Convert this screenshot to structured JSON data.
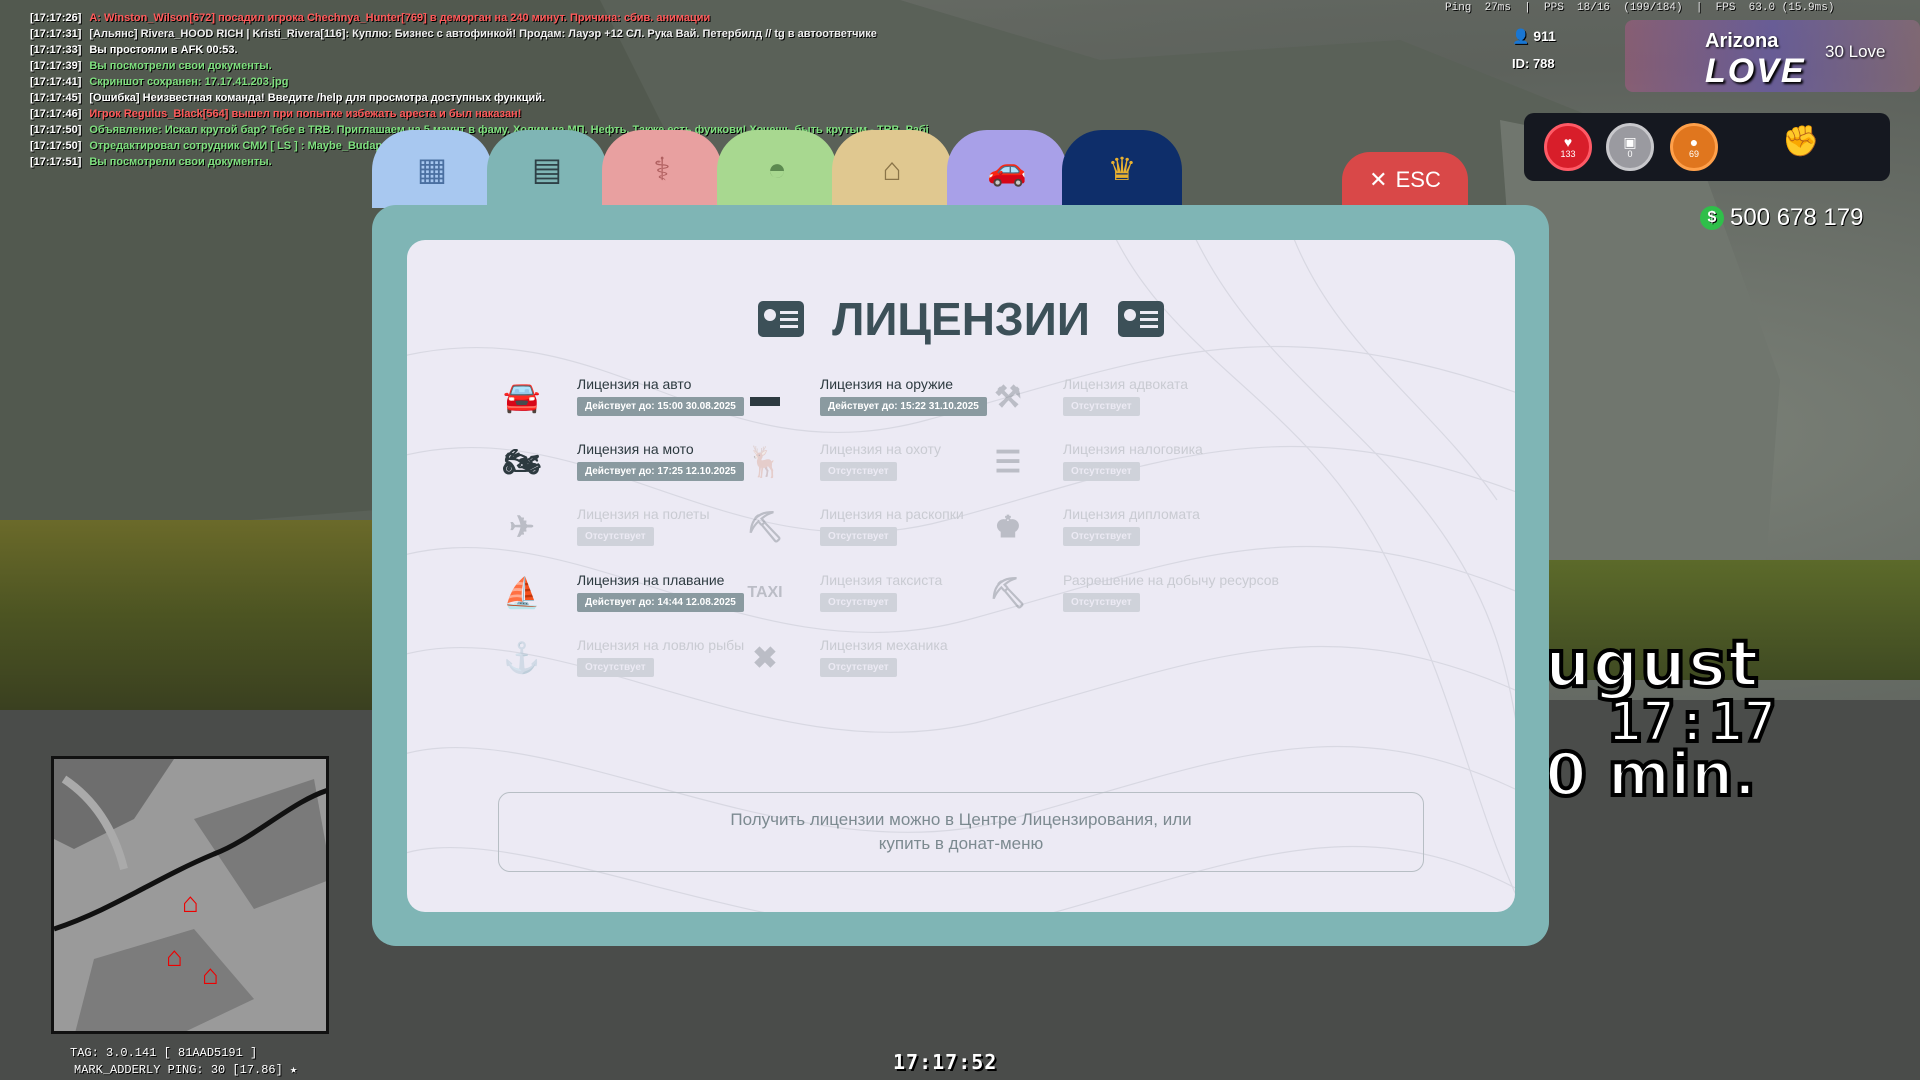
{
  "chat": [
    {
      "time": "[17:17:26]",
      "text": "A: Winston_Wilson[672] посадил игрока Chechnya_Hunter[769] в деморган на 240 минут. Причина: сбив. анимации",
      "color": "#ff5a5a"
    },
    {
      "time": "[17:17:31]",
      "text": "[Альянс] Rivera_HOOD RICH | Kristi_Rivera[116]: Куплю: Бизнес с автофинкой! Продам: Лауэр +12 СЛ. Рука Вай. Петербилд // tg в автоответчике",
      "color": "#f0f0f0"
    },
    {
      "time": "[17:17:33]",
      "text": "Вы простояли в AFK 00:53.",
      "color": "#ffffff"
    },
    {
      "time": "[17:17:39]",
      "text": "Вы посмотрели свои документы.",
      "color": "#7fe07f"
    },
    {
      "time": "[17:17:41]",
      "text": "Скриншот сохранен: 17.17.41.203.jpg",
      "color": "#7fe07f"
    },
    {
      "time": "[17:17:45]",
      "text": "[Ошибка] Неизвестная команда! Введите /help для просмотра доступных функций.",
      "color": "#ffffff"
    },
    {
      "time": "[17:17:46]",
      "text": "Игрок Regulus_Black[564] вышел при попытке избежать ареста и был наказан!",
      "color": "#ff5a5a"
    },
    {
      "time": "[17:17:50]",
      "text": "Объявление: Искал крутой бар? Тебе в TRB. Приглашаем на 5 маунт в фаму. Холим на МП. Нефть. Также есть фуикови! Хочешь быть крутым - TRB. Рабі",
      "color": "#7fe07f"
    },
    {
      "time": "[17:17:50]",
      "text": "Отредактировал сотрудник СМИ [ LS ] : Maybe_Budapest",
      "color": "#7fe07f"
    },
    {
      "time": "[17:17:51]",
      "text": "Вы посмотрели свои документы.",
      "color": "#7fe07f"
    }
  ],
  "hud": {
    "netstats": "Ping  27ms  |  PPS  18/16  (199/184)  |  FPS  63.0 (15.9ms)",
    "players_online": "911",
    "player_id": "ID: 788",
    "server_name": "Arizona",
    "server_logo_text": "LOVE",
    "server_number": "30  Love",
    "health": "133",
    "armor": "0",
    "food": "69",
    "money_symbol": "$",
    "money": "500 678 179",
    "game_date": "ugust",
    "game_clock": "17:17",
    "game_min": "0 min.",
    "tag_line": "TAG: 3.0.141 [ 81AAD5191 ]",
    "user_line": "MARK_ADDERLY    PING: 30 [17.86] ★",
    "bottom_time": "17:17:52"
  },
  "window": {
    "esc_label": "ESC",
    "title": "ЛИЦЕНЗИИ",
    "notice_line1": "Получить лицензии можно в Центре Лицензирования, или",
    "notice_line2": "купить в донат-меню",
    "tabs": [
      {
        "name": "passport",
        "icon": "passport-icon"
      },
      {
        "name": "licenses",
        "icon": "id-card-icon"
      },
      {
        "name": "medical",
        "icon": "medical-icon"
      },
      {
        "name": "military",
        "icon": "helmet-icon"
      },
      {
        "name": "property",
        "icon": "house-icon"
      },
      {
        "name": "vehicles",
        "icon": "car-icon"
      },
      {
        "name": "donate",
        "icon": "crown-icon"
      }
    ],
    "licenses": [
      {
        "name": "Лицензия на авто",
        "status": "Действует до: 15:00 30.08.2025",
        "active": true,
        "icon": "car-icon"
      },
      {
        "name": "Лицензия на оружие",
        "status": "Действует до: 15:22 31.10.2025",
        "active": true,
        "icon": "pistol-icon"
      },
      {
        "name": "Лицензия адвоката",
        "status": "Отсутствует",
        "active": false,
        "icon": "gavel-icon"
      },
      {
        "name": "Лицензия на мото",
        "status": "Действует до: 17:25 12.10.2025",
        "active": true,
        "icon": "motorcycle-icon"
      },
      {
        "name": "Лицензия на охоту",
        "status": "Отсутствует",
        "active": false,
        "icon": "deer-icon"
      },
      {
        "name": "Лицензия налоговика",
        "status": "Отсутствует",
        "active": false,
        "icon": "document-icon"
      },
      {
        "name": "Лицензия на полеты",
        "status": "Отсутствует",
        "active": false,
        "icon": "plane-icon"
      },
      {
        "name": "Лицензия на раскопки",
        "status": "Отсутствует",
        "active": false,
        "icon": "shovel-icon"
      },
      {
        "name": "Лицензия дипломата",
        "status": "Отсутствует",
        "active": false,
        "icon": "diplomat-icon"
      },
      {
        "name": "Лицензия на плавание",
        "status": "Действует до: 14:44 12.08.2025",
        "active": true,
        "icon": "boat-icon"
      },
      {
        "name": "Лицензия таксиста",
        "status": "Отсутствует",
        "active": false,
        "icon": "taxi-icon"
      },
      {
        "name": "Разрешение на добычу ресурсов",
        "status": "Отсутствует",
        "active": false,
        "icon": "pickaxe-icon"
      },
      {
        "name": "Лицензия на ловлю рыбы",
        "status": "Отсутствует",
        "active": false,
        "icon": "fish-hook-icon"
      },
      {
        "name": "Лицензия механика",
        "status": "Отсутствует",
        "active": false,
        "icon": "wrench-icon"
      }
    ]
  }
}
